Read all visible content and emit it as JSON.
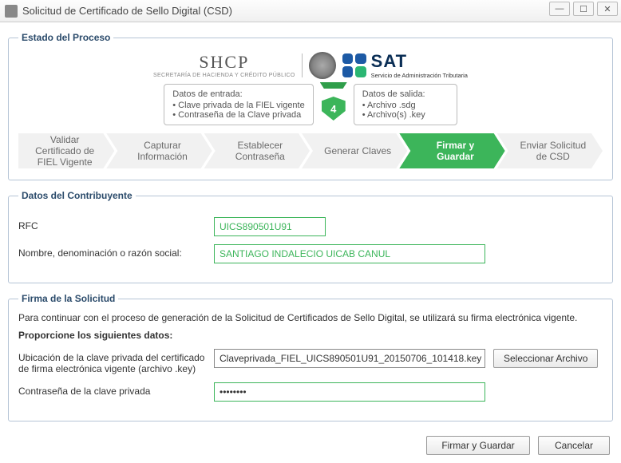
{
  "window": {
    "title": "Solicitud de Certificado de Sello Digital (CSD)"
  },
  "logos": {
    "shcp_big": "SHCP",
    "shcp_small": "SECRETARÍA DE HACIENDA Y CRÉDITO PÚBLICO",
    "sat_big": "SAT",
    "sat_small": "Servicio de Administración Tributaria"
  },
  "proceso": {
    "legend": "Estado del Proceso",
    "entrada": {
      "header": "Datos de entrada:",
      "l1": "• Clave privada de la FIEL vigente",
      "l2": "• Contraseña de la Clave privada"
    },
    "step_number": "4",
    "salida": {
      "header": "Datos de salida:",
      "l1": "• Archivo .sdg",
      "l2": "• Archivo(s) .key"
    },
    "steps": {
      "s1": "Validar Certificado de FIEL Vigente",
      "s2": "Capturar Información",
      "s3": "Establecer Contraseña",
      "s4": "Generar Claves",
      "s5": "Firmar y Guardar",
      "s6": "Enviar Solicitud de CSD"
    }
  },
  "contribuyente": {
    "legend": "Datos del Contribuyente",
    "rfc_label": "RFC",
    "rfc_value": "UICS890501U91",
    "nombre_label": "Nombre, denominación o razón social:",
    "nombre_value": "SANTIAGO INDALECIO UICAB CANUL"
  },
  "firma": {
    "legend": "Firma de la Solicitud",
    "intro": "Para continuar con el proceso de generación de la Solicitud de Certificados de Sello Digital, se utilizará su firma electrónica vigente.",
    "proporcione": "Proporcione los siguientes datos:",
    "ubic_label": "Ubicación de la clave privada del certificado de firma electrónica vigente (archivo .key)",
    "ubic_value": "Claveprivada_FIEL_UICS890501U91_20150706_101418.key",
    "browse_btn": "Seleccionar Archivo",
    "pwd_label": "Contraseña de la clave privada",
    "pwd_value": "••••••••"
  },
  "footer": {
    "firmar": "Firmar y Guardar",
    "cancelar": "Cancelar"
  }
}
